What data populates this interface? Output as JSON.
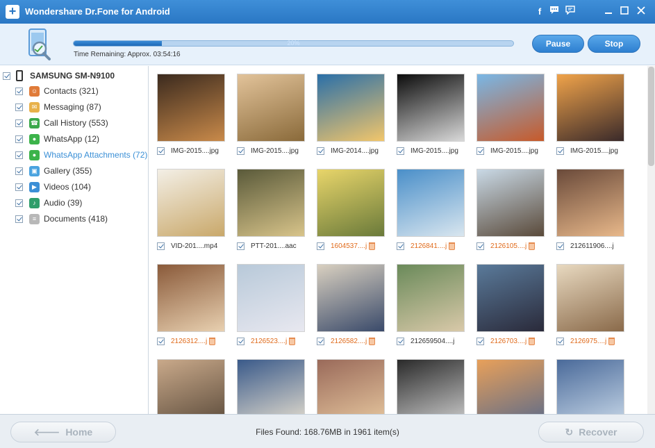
{
  "window": {
    "title": "Wondershare Dr.Fone for Android",
    "controls": [
      "facebook-icon",
      "chat-icon",
      "feedback-icon",
      "minimize-icon",
      "maximize-icon",
      "close-icon"
    ]
  },
  "scan": {
    "progress_percent": 20,
    "progress_label": "20%",
    "time_remaining": "Time Remaining: Approx. 03:54:16",
    "pause_label": "Pause",
    "stop_label": "Stop"
  },
  "sidebar": {
    "device": "SAMSUNG SM-N9100",
    "items": [
      {
        "label": "Contacts  (321)",
        "icon": "contacts-icon",
        "color": "#e07b39"
      },
      {
        "label": "Messaging  (87)",
        "icon": "messaging-icon",
        "color": "#e8b14a"
      },
      {
        "label": "Call History  (553)",
        "icon": "call-history-icon",
        "color": "#3aa84a"
      },
      {
        "label": "WhatsApp  (12)",
        "icon": "whatsapp-icon",
        "color": "#3cb34a"
      },
      {
        "label": "WhatsApp Attachments  (72)",
        "icon": "whatsapp-attachments-icon",
        "color": "#3cb34a"
      },
      {
        "label": "Gallery  (355)",
        "icon": "gallery-icon",
        "color": "#4aa3df"
      },
      {
        "label": "Videos  (104)",
        "icon": "videos-icon",
        "color": "#3c8fd6"
      },
      {
        "label": "Audio  (39)",
        "icon": "audio-icon",
        "color": "#2f9e6b"
      },
      {
        "label": "Documents  (418)",
        "icon": "documents-icon",
        "color": "#b8b8b8"
      }
    ]
  },
  "grid": {
    "files": [
      {
        "name": "IMG-2015....jpg",
        "deleted": false
      },
      {
        "name": "IMG-2015....jpg",
        "deleted": false
      },
      {
        "name": "IMG-2014....jpg",
        "deleted": false
      },
      {
        "name": "IMG-2015....jpg",
        "deleted": false
      },
      {
        "name": "IMG-2015....jpg",
        "deleted": false
      },
      {
        "name": "IMG-2015....jpg",
        "deleted": false
      },
      {
        "name": "VID-201....mp4",
        "deleted": false
      },
      {
        "name": "PTT-201....aac",
        "deleted": false
      },
      {
        "name": "1604537....j",
        "deleted": true
      },
      {
        "name": "2126841....j",
        "deleted": true
      },
      {
        "name": "2126105....j",
        "deleted": true
      },
      {
        "name": "212611906....j",
        "deleted": false
      },
      {
        "name": "2126312....j",
        "deleted": true
      },
      {
        "name": "2126523....j",
        "deleted": true
      },
      {
        "name": "2126582....j",
        "deleted": true
      },
      {
        "name": "212659504....j",
        "deleted": false
      },
      {
        "name": "2126703....j",
        "deleted": true
      },
      {
        "name": "2126975....j",
        "deleted": true
      },
      {
        "name": "",
        "deleted": false
      },
      {
        "name": "",
        "deleted": false
      },
      {
        "name": "",
        "deleted": false
      },
      {
        "name": "",
        "deleted": false
      },
      {
        "name": "",
        "deleted": false
      },
      {
        "name": "",
        "deleted": false
      }
    ]
  },
  "footer": {
    "home_label": "Home",
    "recover_label": "Recover",
    "files_found": "Files Found: 168.76MB in 1961 item(s)"
  }
}
